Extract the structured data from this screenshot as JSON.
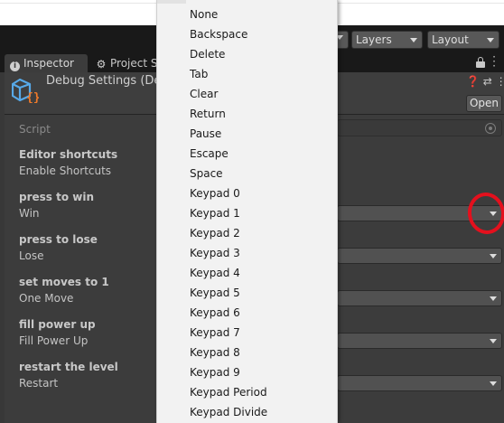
{
  "toolbar": {
    "layers_label": "Layers",
    "layout_label": "Layout"
  },
  "tabs": [
    {
      "label": "Inspector",
      "icon": "info-icon"
    },
    {
      "label": "Project S",
      "icon": "gear-icon"
    }
  ],
  "header": {
    "title": "Debug Settings (De",
    "open_label": "Open"
  },
  "script": {
    "label": "Script"
  },
  "sections": [
    {
      "heading": "Editor shortcuts",
      "label": "Enable Shortcuts"
    },
    {
      "heading": "press to win",
      "label": "Win"
    },
    {
      "heading": "press to lose",
      "label": "Lose"
    },
    {
      "heading": "set moves to 1",
      "label": "One Move"
    },
    {
      "heading": "fill power up",
      "label": "Fill Power Up"
    },
    {
      "heading": "restart the level",
      "label": "Restart"
    }
  ],
  "dropdown_menu": {
    "items": [
      "None",
      "Backspace",
      "Delete",
      "Tab",
      "Clear",
      "Return",
      "Pause",
      "Escape",
      "Space",
      "Keypad 0",
      "Keypad 1",
      "Keypad 2",
      "Keypad 3",
      "Keypad 4",
      "Keypad 5",
      "Keypad 6",
      "Keypad 7",
      "Keypad 8",
      "Keypad 9",
      "Keypad Period",
      "Keypad Divide"
    ]
  },
  "colors": {
    "editor_bg": "#383838",
    "panel_bg": "#3c3c3c",
    "menu_bg": "#f2f2f2",
    "annotation_red": "#e4101d"
  }
}
